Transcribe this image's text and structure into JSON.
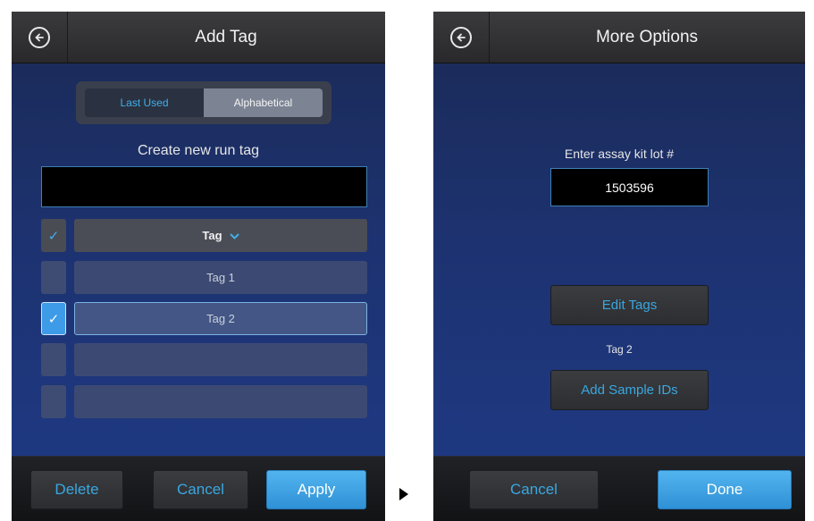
{
  "left": {
    "title": "Add Tag",
    "segments": [
      "Last Used",
      "Alphabetical"
    ],
    "create_label": "Create new run tag",
    "new_tag_value": "",
    "tag_header": "Tag",
    "tags": [
      {
        "label": "Tag 1",
        "checked": false
      },
      {
        "label": "Tag 2",
        "checked": true
      },
      {
        "label": "",
        "checked": false
      },
      {
        "label": "",
        "checked": false
      }
    ],
    "footer": {
      "delete": "Delete",
      "cancel": "Cancel",
      "apply": "Apply"
    }
  },
  "right": {
    "title": "More Options",
    "lot_label": "Enter assay kit lot #",
    "lot_value": "1503596",
    "edit_tags": "Edit Tags",
    "current_tag": "Tag 2",
    "add_sample_ids": "Add Sample IDs",
    "footer": {
      "cancel": "Cancel",
      "done": "Done"
    }
  },
  "icons": {
    "back": "back-arrow-icon",
    "checkmark": "checkmark-icon",
    "chevron": "chevron-down-icon",
    "transition": "play-arrow-icon"
  },
  "colors": {
    "accent": "#3fb0ea",
    "primary_button": "#3d9be8",
    "background": "#1d3270"
  }
}
